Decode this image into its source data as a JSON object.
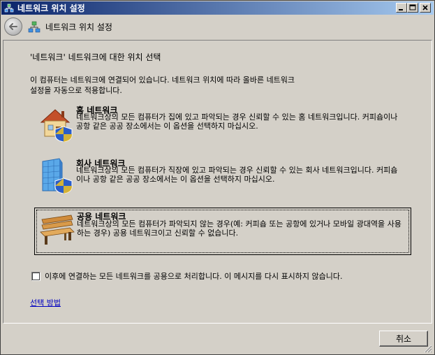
{
  "window": {
    "title": "네트워크 위치 설정",
    "minimize_label": "_",
    "maximize_label": "□",
    "close_label": "×"
  },
  "nav": {
    "title": "네트워크 위치 설정"
  },
  "main": {
    "heading": "'네트워크' 네트워크에 대한 위치 선택",
    "description_line1": "이 컴퓨터는 네트워크에 연결되어 있습니다. 네트워크 위치에 따라 올바른 네트워크",
    "description_line2": "설정을 자동으로 적용합니다.",
    "options": [
      {
        "title": "홈 네트워크",
        "description": "네트워크상의 모든 컴퓨터가 집에 있고 파악되는 경우 신뢰할 수 있는 홈 네트워크입니다. 커피숍이나 공항 같은 공공 장소에서는 이 옵션을 선택하지 마십시오.",
        "icon": "house-shield-icon"
      },
      {
        "title": "회사 네트워크",
        "description": "네트워크상의 모든 컴퓨터가 직장에 있고 파악되는 경우 신뢰할 수 있는 회사 네트워크입니다. 커피숍이나 공항 같은 공공 장소에서는 이 옵션을 선택하지 마십시오.",
        "icon": "office-building-shield-icon"
      },
      {
        "title": "공용 네트워크",
        "description": "네트워크상의 모든 컴퓨터가 파악되지 않는 경우(예: 커피숍 또는 공항에 있거나 모바일 광대역을 사용하는 경우) 공용 네트워크이고 신뢰할 수 없습니다.",
        "icon": "park-bench-icon"
      }
    ],
    "checkbox_label": "이후에 연결하는 모든 네트워크를 공용으로 처리합니다. 이 메시지를 다시 표시하지 않습니다.",
    "checkbox_checked": false,
    "help_link": "선택 방법"
  },
  "footer": {
    "cancel_label": "취소"
  },
  "colors": {
    "titlebar_start": "#0a246a",
    "titlebar_end": "#a6caf0",
    "link": "#0000c0",
    "face": "#d4d0c8"
  }
}
